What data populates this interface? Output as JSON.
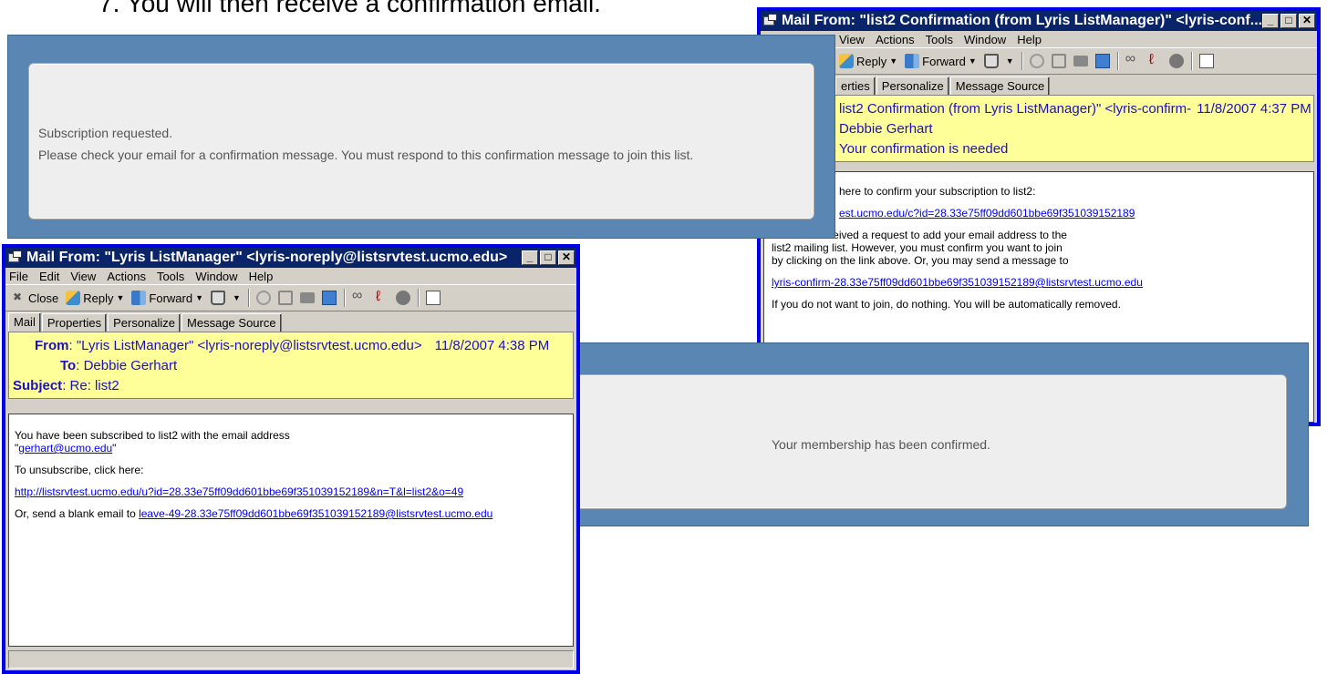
{
  "step_text": "7.  You will then receive a confirmation email.",
  "panel_requested": {
    "line1": "Subscription requested.",
    "line2": "Please check your email for a confirmation message. You must respond to this confirmation message to join this list."
  },
  "panel_confirmed": {
    "message": "Your membership has been confirmed."
  },
  "window_confirm": {
    "title": "Mail From: \"list2 Confirmation (from Lyris ListManager)\" <lyris-conf...",
    "menu": [
      "View",
      "Actions",
      "Tools",
      "Window",
      "Help"
    ],
    "toolbar": {
      "reply": "Reply",
      "forward": "Forward"
    },
    "tabs": [
      "erties",
      "Personalize",
      "Message Source"
    ],
    "from": "list2 Confirmation (from Lyris ListManager)\" <lyris-confirm-",
    "date": "11/8/2007 4:37 PM",
    "to": "Debbie Gerhart",
    "subject": "Your confirmation is needed",
    "body": {
      "line1": "here to confirm your subscription to list2:",
      "link1": "est.ucmo.edu/c?id=28.33e75ff09dd601bbe69f351039152189",
      "para1": "We have received a request to add your email address to the",
      "para2": "list2 mailing list. However, you must confirm you want to join",
      "para3": "by clicking on the link above.  Or, you may send a message to",
      "link2": "lyris-confirm-28.33e75ff09dd601bbe69f351039152189@listsrvtest.ucmo.edu",
      "line_last": "If you do not want to join, do nothing.  You will be automatically removed."
    }
  },
  "window_subscribed": {
    "title": "Mail From: \"Lyris ListManager\" <lyris-noreply@listsrvtest.ucmo.edu>",
    "menu": [
      "File",
      "Edit",
      "View",
      "Actions",
      "Tools",
      "Window",
      "Help"
    ],
    "toolbar": {
      "close": "Close",
      "reply": "Reply",
      "forward": "Forward"
    },
    "tabs": [
      "Mail",
      "Properties",
      "Personalize",
      "Message Source"
    ],
    "from_label": "From",
    "from": "\"Lyris ListManager\" <lyris-noreply@listsrvtest.ucmo.edu>",
    "date": "11/8/2007 4:38 PM",
    "to_label": "To",
    "to": "Debbie Gerhart",
    "subject_label": "Subject",
    "subject": "Re: list2",
    "body": {
      "line1": "You have been subscribed to list2 with the email address",
      "email_quote_open": "\"",
      "email": "gerhart@ucmo.edu",
      "email_quote_close": "\"",
      "unsub": "To unsubscribe, click here:",
      "unsub_link": "http://listsrvtest.ucmo.edu/u?id=28.33e75ff09dd601bbe69f351039152189&n=T&l=list2&o=49",
      "blank_prefix": "Or, send a blank email to ",
      "blank_link": "leave-49-28.33e75ff09dd601bbe69f351039152189@listsrvtest.ucmo.edu"
    }
  }
}
